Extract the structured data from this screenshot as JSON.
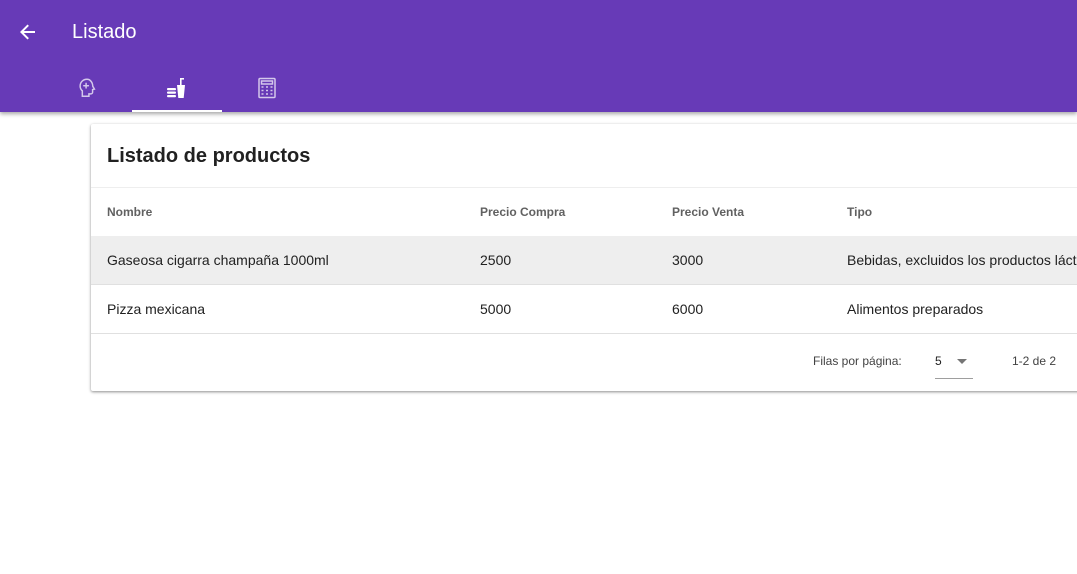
{
  "app_bar": {
    "title": "Listado",
    "back_icon": "arrow-left-icon",
    "background": "#673ab7",
    "tabs": [
      {
        "icon": "head-plus-icon",
        "active": false
      },
      {
        "icon": "food-drink-icon",
        "active": true
      },
      {
        "icon": "calculator-icon",
        "active": false
      }
    ]
  },
  "card": {
    "title": "Listado de productos",
    "columns": [
      "Nombre",
      "Precio Compra",
      "Precio Venta",
      "Tipo"
    ],
    "rows": [
      [
        "Gaseosa cigarra champaña 1000ml",
        "2500",
        "3000",
        "Bebidas, excluidos los productos lácteos"
      ],
      [
        "Pizza mexicana",
        "5000",
        "6000",
        "Alimentos preparados"
      ]
    ],
    "highlighted_row_color": "#eeeeee"
  },
  "pagination": {
    "rows_per_page_label": "Filas por página:",
    "rows_per_page_value": "5",
    "range_text": "1-2 de 2"
  }
}
